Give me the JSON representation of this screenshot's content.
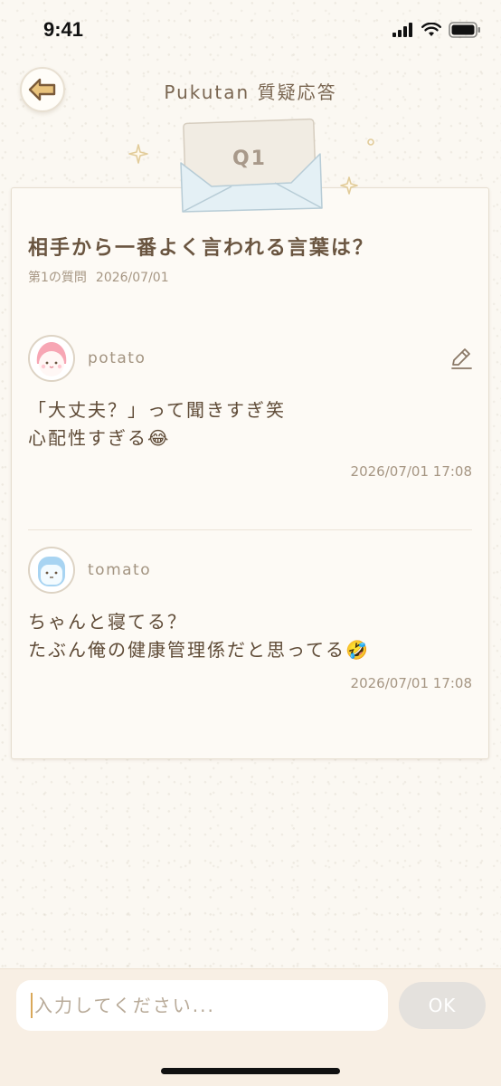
{
  "status_bar": {
    "time": "9:41",
    "icons": [
      "signal-icon",
      "wifi-icon",
      "battery-icon"
    ]
  },
  "header": {
    "title": "Pukutan 質疑応答",
    "back_icon": "back-arrow-icon"
  },
  "envelope": {
    "label": "Q1"
  },
  "question": {
    "title": "相手から一番よく言われる言葉は？",
    "number_label": "第1の質問",
    "date": "2026/07/01"
  },
  "answers": [
    {
      "username": "potato",
      "avatar": "pink-avatar",
      "line1": "「大丈夫？」って聞きすぎ笑",
      "line2": "心配性すぎる😂",
      "timestamp": "2026/07/01  17:08",
      "editable": true
    },
    {
      "username": "tomato",
      "avatar": "blue-avatar",
      "line1": "ちゃんと寝てる？",
      "line2": "たぶん俺の健康管理係だと思ってる🤣",
      "timestamp": "2026/07/01  17:08",
      "editable": false
    }
  ],
  "composer": {
    "placeholder": "入力してください...",
    "value": "",
    "submit_label": "OK"
  },
  "colors": {
    "background": "#fbf8f2",
    "text": "#6a5540",
    "accent": "#d9a85a",
    "button_disabled": "#e4e1dd"
  }
}
